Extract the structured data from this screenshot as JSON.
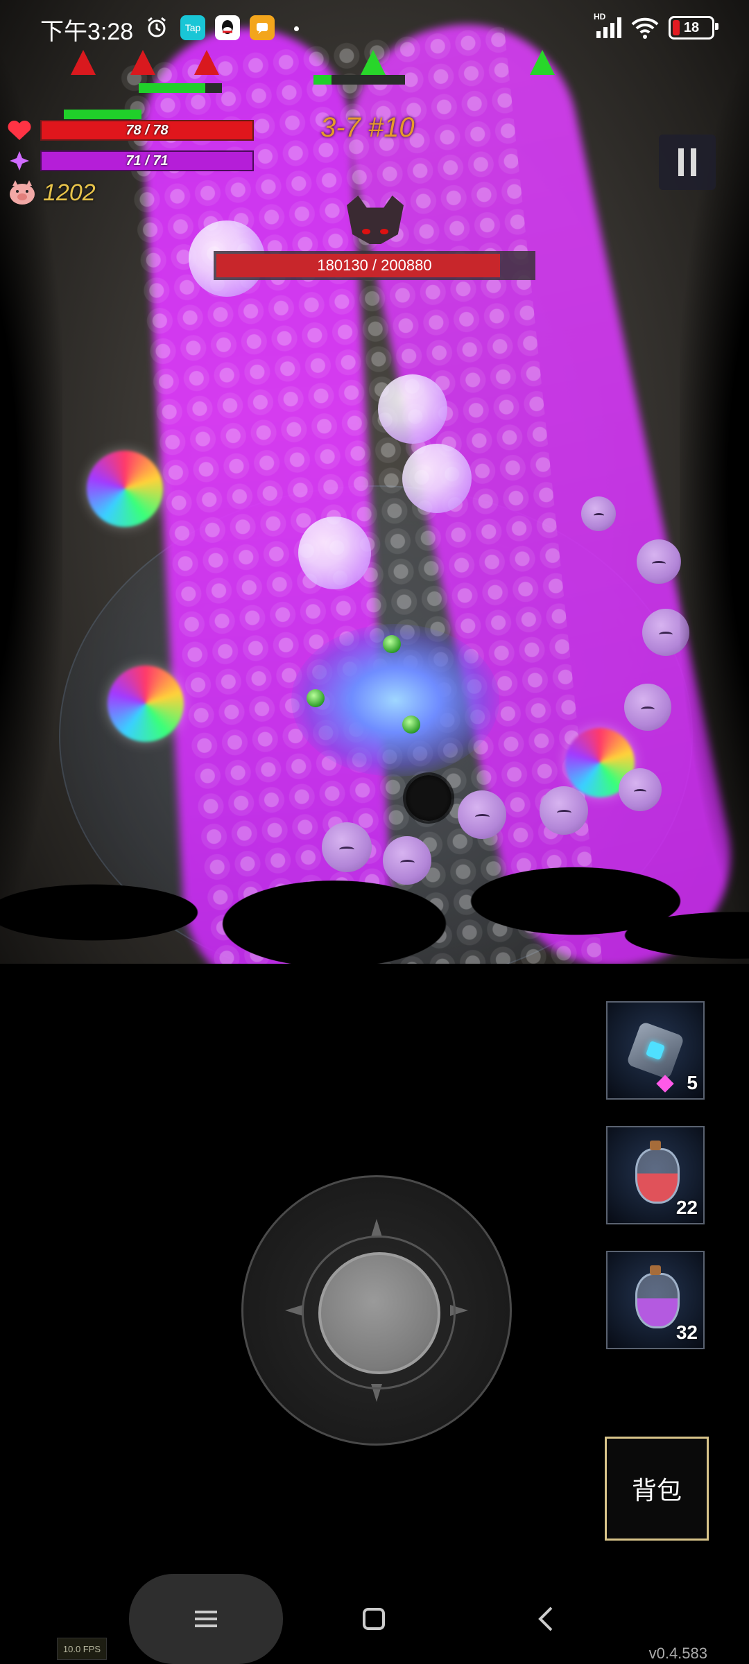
{
  "status_bar": {
    "time": "下午3:28",
    "app_icons": [
      "alarm-icon",
      "tap-app-icon",
      "qq-icon",
      "message-app-icon"
    ],
    "tap_label": "Tap",
    "network": "HD",
    "battery": "18"
  },
  "hud": {
    "hp_text": "78 / 78",
    "mp_text": "71 / 71",
    "gold": "1202",
    "stage": "3-7 #10",
    "pause_icon": "pause-icon"
  },
  "boss": {
    "hp_text": "180130 / 200880",
    "hp_fraction": 0.897
  },
  "inventory": [
    {
      "name": "cube-skill",
      "icon": "cube-icon",
      "count": "5",
      "cost_icon": "gem-icon"
    },
    {
      "name": "red-potion",
      "icon": "red-potion-icon",
      "count": "22"
    },
    {
      "name": "purple-potion",
      "icon": "purple-potion-icon",
      "count": "32"
    }
  ],
  "bag_label": "背包",
  "fps": "10.0 FPS",
  "version": "v0.4.583",
  "colors": {
    "hp": "#e0161c",
    "mp": "#b51ed8",
    "gold": "#e7c34a",
    "stage": "#e69a2b",
    "beam": "#e040ff"
  }
}
